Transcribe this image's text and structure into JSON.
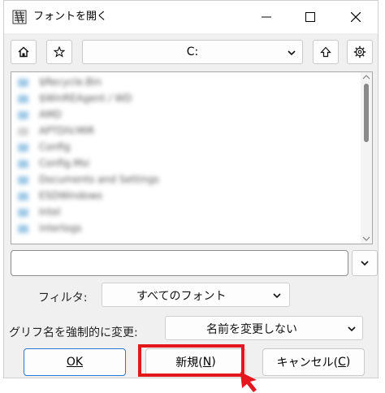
{
  "window": {
    "title": "フォントを開く"
  },
  "toolbar": {
    "path": "C:"
  },
  "file_list": {
    "items": [
      {
        "name": "$Recycle.Bin",
        "icon": "folder-icon"
      },
      {
        "name": "$WinREAgent / WD",
        "icon": "folder-icon"
      },
      {
        "name": "AMD",
        "icon": "folder-icon"
      },
      {
        "name": "APTDIV.MIR",
        "icon": "file-icon"
      },
      {
        "name": "Config",
        "icon": "folder-icon"
      },
      {
        "name": "Config.Msi",
        "icon": "folder-icon"
      },
      {
        "name": "Documents and Settings",
        "icon": "folder-icon"
      },
      {
        "name": "ESDWindows",
        "icon": "folder-icon"
      },
      {
        "name": "Intel",
        "icon": "folder-icon"
      },
      {
        "name": "interlogs",
        "icon": "folder-icon"
      }
    ]
  },
  "filename_input": {
    "value": ""
  },
  "filter": {
    "label": "フィルタ:",
    "selected": "すべてのフォント"
  },
  "rename": {
    "label": "グリフ名を強制的に変更:",
    "selected": "名前を変更しない"
  },
  "buttons": {
    "ok_label": "OK",
    "ok_mnemonic": "O",
    "new_label": "新規(N)",
    "new_prefix": "新規(",
    "new_mnemonic": "N",
    "cancel_label": "キャンセル(C)",
    "cancel_prefix": "キャンセル(",
    "cancel_mnemonic": "C"
  },
  "colors": {
    "highlight": "#e4161d",
    "ok_border": "#2b78d4"
  }
}
